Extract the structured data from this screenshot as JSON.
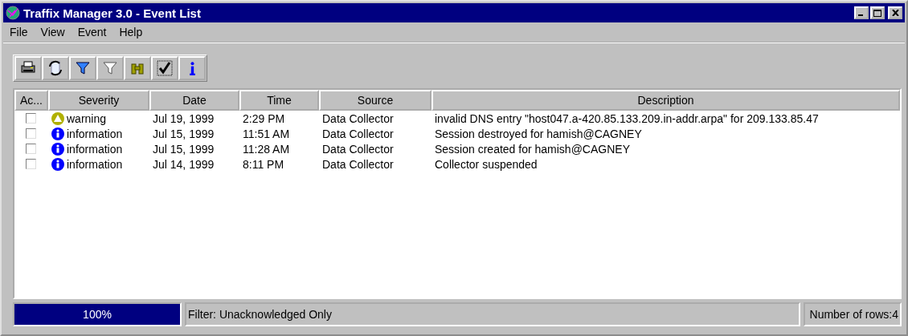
{
  "window": {
    "title": "Traffix Manager 3.0 - Event List"
  },
  "menu": [
    "File",
    "View",
    "Event",
    "Help"
  ],
  "table": {
    "columns": [
      "Ac...",
      "Severity",
      "Date",
      "Time",
      "Source",
      "Description"
    ],
    "rows": [
      {
        "acknowledged": false,
        "severity": {
          "kind": "warning",
          "label": "warning"
        },
        "date": "Jul 19, 1999",
        "time": "2:29 PM",
        "source": "Data Collector",
        "description": "invalid DNS entry \"host047.a-420.85.133.209.in-addr.arpa\" for 209.133.85.47"
      },
      {
        "acknowledged": false,
        "severity": {
          "kind": "information",
          "label": "information"
        },
        "date": "Jul 15, 1999",
        "time": "11:51 AM",
        "source": "Data Collector",
        "description": "Session destroyed for hamish@CAGNEY"
      },
      {
        "acknowledged": false,
        "severity": {
          "kind": "information",
          "label": "information"
        },
        "date": "Jul 15, 1999",
        "time": "11:28 AM",
        "source": "Data Collector",
        "description": "Session created for hamish@CAGNEY"
      },
      {
        "acknowledged": false,
        "severity": {
          "kind": "information",
          "label": "information"
        },
        "date": "Jul 14, 1999",
        "time": "8:11 PM",
        "source": "Data Collector",
        "description": "Collector suspended"
      }
    ]
  },
  "status_bar": {
    "progress": {
      "level": 1,
      "reading": "100%"
    },
    "filter": "Filter: Unacknowledged Only",
    "row_count": "Number of rows:4"
  }
}
